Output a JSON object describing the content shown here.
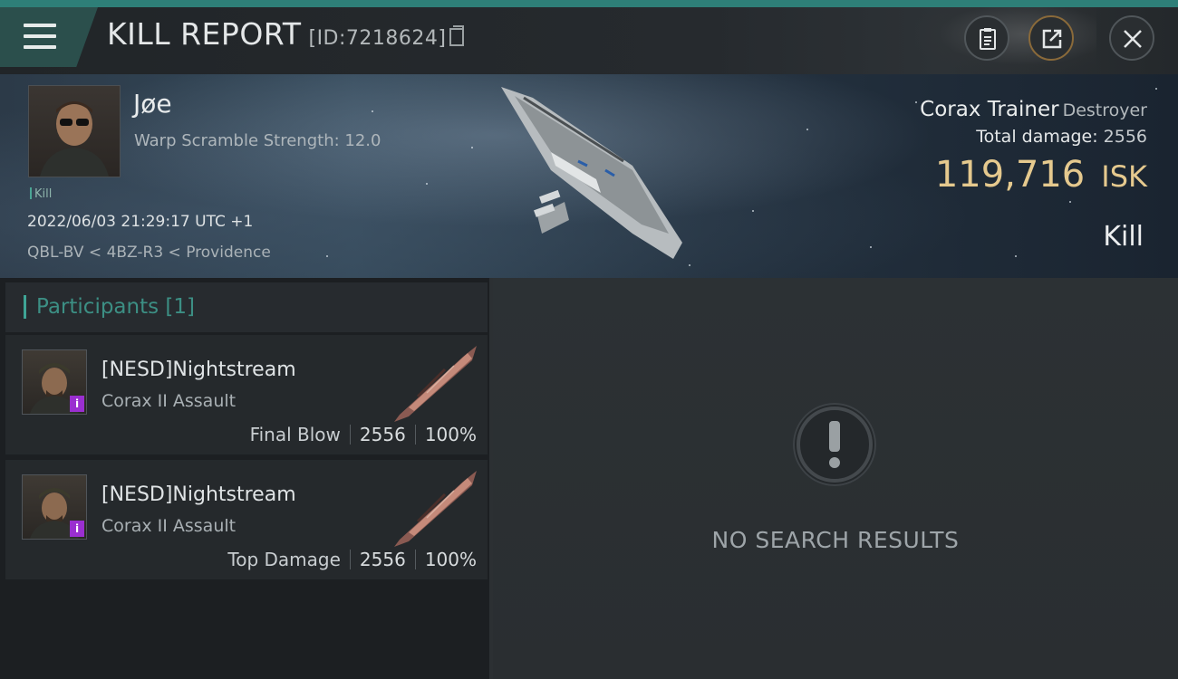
{
  "header": {
    "title": "KILL REPORT",
    "report_id": "[ID:7218624]",
    "buttons": [
      "clipboard-icon",
      "share-icon",
      "close-icon"
    ]
  },
  "victim": {
    "name": "Jøe",
    "scramble": "Warp Scramble Strength: 12.0",
    "tag": "Kill",
    "datetime": "2022/06/03 21:29:17 UTC +1",
    "location": "QBL-BV < 4BZ-R3 < Providence"
  },
  "ship": {
    "name": "Corax Trainer",
    "class": "Destroyer",
    "damage_label": "Total damage:",
    "damage_value": "2556",
    "isk_value": "119,716",
    "isk_unit": "ISK",
    "result": "Kill"
  },
  "participants": {
    "header": "Participants [1]",
    "rows": [
      {
        "name": "[NESD]Nightstream",
        "ship": "Corax II Assault",
        "role": "Final Blow",
        "damage": "2556",
        "percent": "100%"
      },
      {
        "name": "[NESD]Nightstream",
        "ship": "Corax II Assault",
        "role": "Top Damage",
        "damage": "2556",
        "percent": "100%"
      }
    ]
  },
  "empty_state": {
    "icon": "exclamation-icon",
    "text": "NO SEARCH RESULTS"
  },
  "colors": {
    "accent": "#3fa596",
    "isk": "#e5c98e",
    "badge": "#9a2fd0"
  }
}
